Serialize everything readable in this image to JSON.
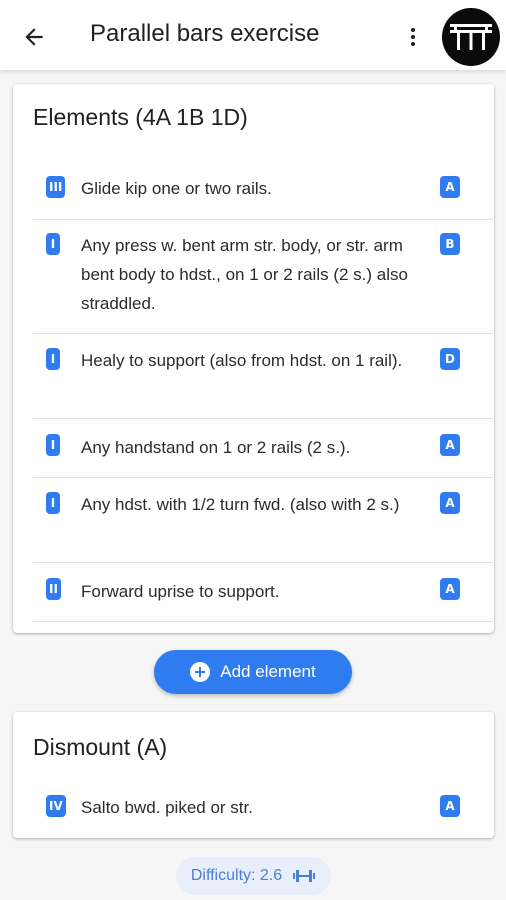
{
  "appbar": {
    "title": "Parallel bars exercise",
    "back_icon": "arrow-back-icon",
    "more_icon": "more-vert-icon",
    "avatar_icon": "parallel-bars-logo"
  },
  "elements_card": {
    "title": "Elements (4A 1B 1D)",
    "items": [
      {
        "level": "III",
        "text": "Glide kip one or two rails.",
        "value": "A"
      },
      {
        "level": "I",
        "text": "Any press w. bent arm str. body, or str. arm bent body to hdst., on 1 or 2 rails (2 s.) also straddled.",
        "value": "B"
      },
      {
        "level": "I",
        "text": "Healy to support (also from hdst. on 1 rail).",
        "value": "D"
      },
      {
        "level": "I",
        "text": "Any handstand on 1 or 2 rails (2 s.).",
        "value": "A"
      },
      {
        "level": "I",
        "text": "Any hdst. with 1/2 turn fwd. (also with 2 s.)",
        "value": "A"
      },
      {
        "level": "II",
        "text": "Forward uprise to support.",
        "value": "A"
      }
    ]
  },
  "add_button": {
    "label": "Add element",
    "icon": "add-circle-icon"
  },
  "dismount_card": {
    "title": "Dismount (A)",
    "item": {
      "level": "IV",
      "text": "Salto bwd. piked or str.",
      "value": "A"
    }
  },
  "difficulty": {
    "label": "Difficulty: 2.6",
    "icon": "dumbbell-icon"
  },
  "colors": {
    "accent": "#2f7cf0",
    "chip_bg": "#e8effb",
    "chip_text": "#4a7ed4"
  }
}
